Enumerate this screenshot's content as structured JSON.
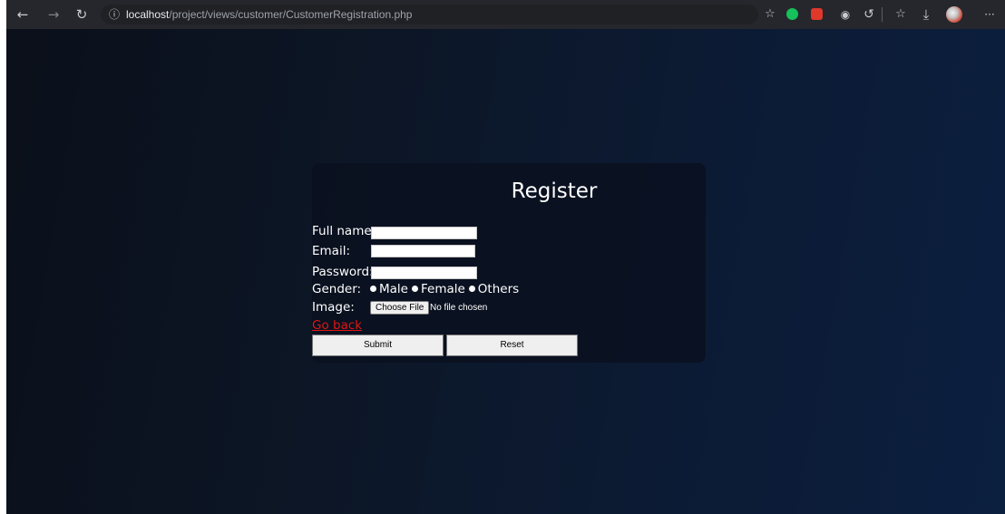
{
  "browser": {
    "url_host": "localhost",
    "url_path": "/project/views/customer/CustomerRegistration.php",
    "more_label": "···"
  },
  "form": {
    "title": "Register",
    "fullname_label": "Full name:",
    "email_label": "Email:",
    "password_label": "Password:",
    "gender_label": "Gender:",
    "gender_options": [
      "Male",
      "Female",
      "Others"
    ],
    "image_label": "Image:",
    "choose_file_label": "Choose File",
    "file_status": "No file chosen",
    "go_back_label": "Go back",
    "submit_label": "Submit",
    "reset_label": "Reset"
  },
  "colors": {
    "link": "#e01414",
    "page_background": "#0c1a30",
    "card_background": "#0a101e"
  }
}
